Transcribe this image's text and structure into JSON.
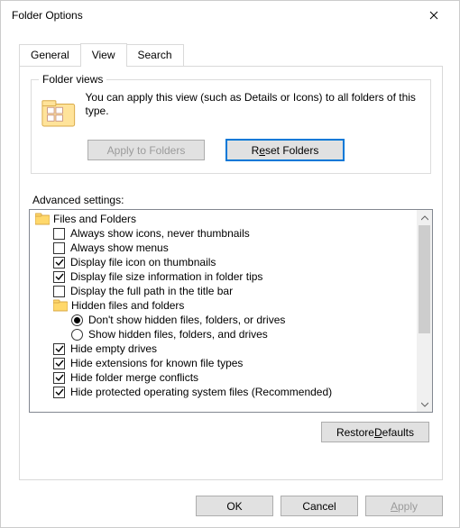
{
  "window": {
    "title": "Folder Options"
  },
  "tabs": {
    "general": "General",
    "view": "View",
    "search": "Search",
    "active": "view"
  },
  "folderViews": {
    "legend": "Folder views",
    "text": "You can apply this view (such as Details or Icons) to all folders of this type.",
    "applyBtn": "Apply to Folders",
    "resetPrefix": "R",
    "resetUnderlined": "e",
    "resetSuffix": "set Folders"
  },
  "advancedLabel": "Advanced settings:",
  "tree": {
    "root": "Files and Folders",
    "item0": "Always show icons, never thumbnails",
    "item1": "Always show menus",
    "item2": "Display file icon on thumbnails",
    "item3": "Display file size information in folder tips",
    "item4": "Display the full path in the title bar",
    "hiddenGroup": "Hidden files and folders",
    "radio0": "Don't show hidden files, folders, or drives",
    "radio1": "Show hidden files, folders, and drives",
    "item5": "Hide empty drives",
    "item6": "Hide extensions for known file types",
    "item7": "Hide folder merge conflicts",
    "item8": "Hide protected operating system files (Recommended)"
  },
  "checked": {
    "item0": false,
    "item1": false,
    "item2": true,
    "item3": true,
    "item4": false,
    "item5": true,
    "item6": true,
    "item7": true,
    "item8": true
  },
  "radioSelected": 0,
  "restore": {
    "prefix": "Restore ",
    "underlined": "D",
    "suffix": "efaults"
  },
  "buttons": {
    "ok": "OK",
    "cancel": "Cancel",
    "apply_prefix": "",
    "apply_underlined": "A",
    "apply_suffix": "pply"
  }
}
